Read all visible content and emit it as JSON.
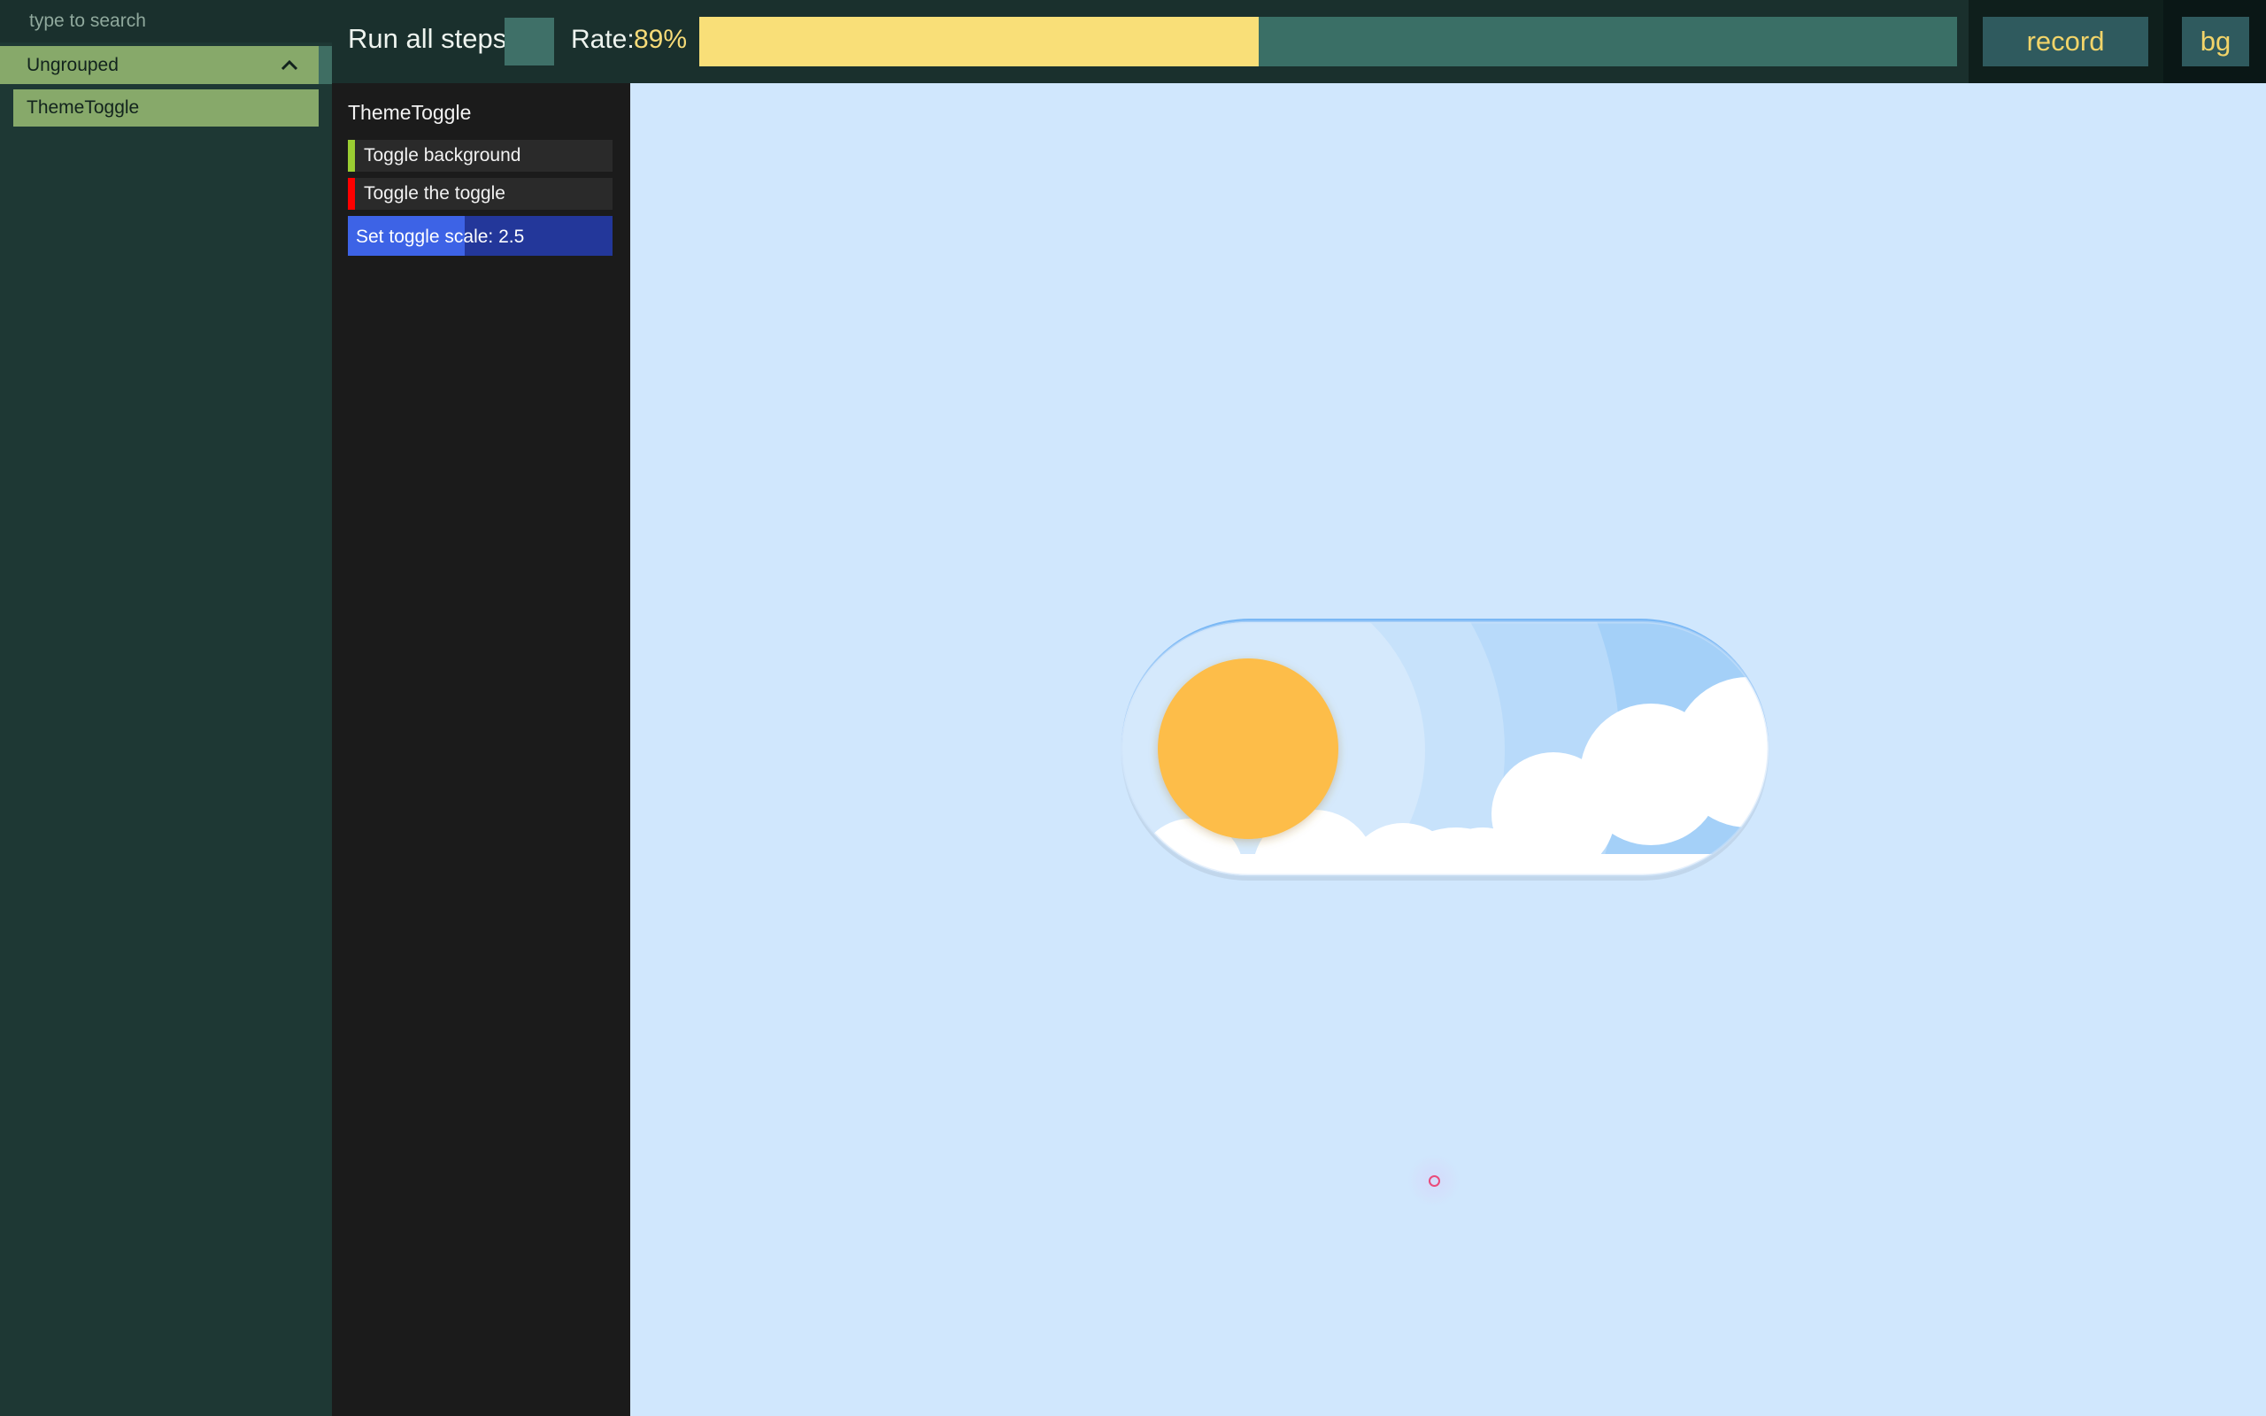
{
  "search": {
    "placeholder": "type to search"
  },
  "sidebar": {
    "group_label": "Ungrouped",
    "items": [
      {
        "label": "ThemeToggle"
      }
    ]
  },
  "toolbar": {
    "run_label": "Run all steps",
    "rate_label": "Rate:",
    "rate_value": "89%",
    "rate_fraction": 0.445,
    "record_label": "record",
    "bg_label": "bg"
  },
  "steps": {
    "title": "ThemeToggle",
    "items": [
      {
        "label": "Toggle background",
        "status_color": "#9acd32"
      },
      {
        "label": "Toggle the toggle",
        "status_color": "#ff0000"
      },
      {
        "label": "Set toggle scale: 2.5",
        "progress_fraction": 0.44
      }
    ]
  },
  "colors": {
    "sun": "#fdbd48",
    "canvas_bg": "#d0e7fd",
    "toggle_border": "#7ab8f5"
  },
  "icons": {
    "group_chevron": "chevron-up-icon",
    "toggle_sun": "sun-icon",
    "toggle_clouds": "cloud-icon",
    "cursor": "cursor-indicator-icon"
  }
}
